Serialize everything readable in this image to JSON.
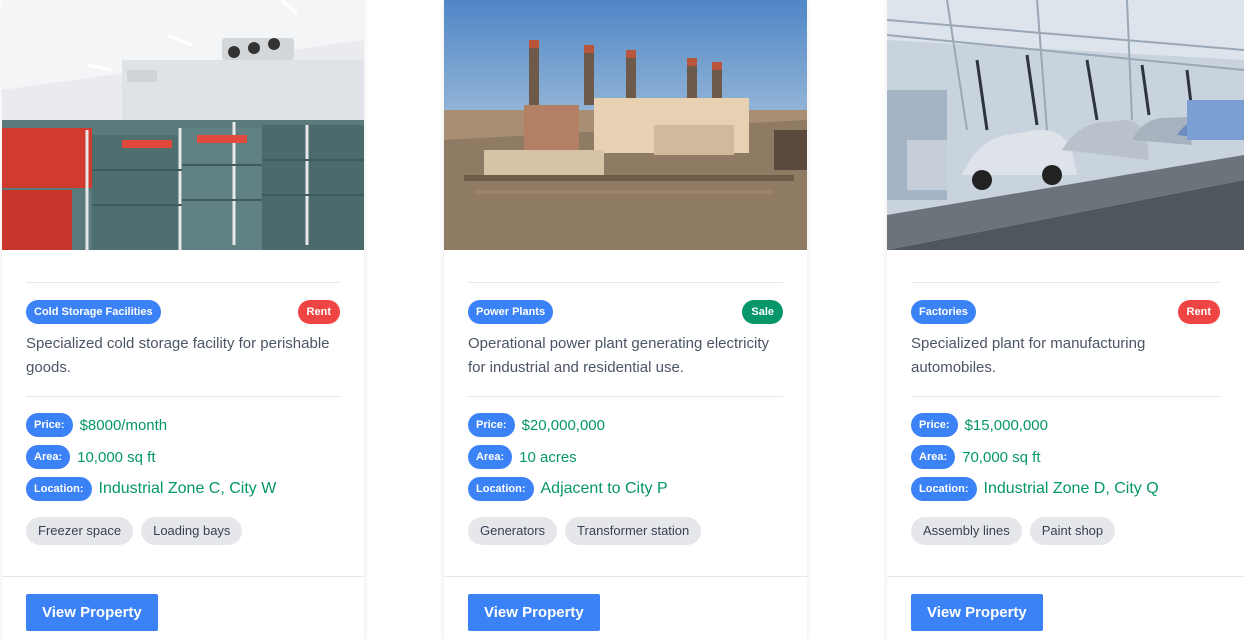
{
  "cards": [
    {
      "category": "Cold Storage Facilities",
      "deal": "Rent",
      "description": "Specialized cold storage facility for perishable goods.",
      "price_label": "Price:",
      "price": "$8000/month",
      "area_label": "Area:",
      "area": "10,000 sq ft",
      "location_label": "Location:",
      "location": "Industrial Zone C, City W",
      "features": [
        "Freezer space",
        "Loading bays"
      ],
      "button": "View Property"
    },
    {
      "category": "Power Plants",
      "deal": "Sale",
      "description": "Operational power plant generating electricity for industrial and residential use.",
      "price_label": "Price:",
      "price": "$20,000,000",
      "area_label": "Area:",
      "area": "10 acres",
      "location_label": "Location:",
      "location": "Adjacent to City P",
      "features": [
        "Generators",
        "Transformer station"
      ],
      "button": "View Property"
    },
    {
      "category": "Factories",
      "deal": "Rent",
      "description": "Specialized plant for manufacturing automobiles.",
      "price_label": "Price:",
      "price": "$15,000,000",
      "area_label": "Area:",
      "area": "70,000 sq ft",
      "location_label": "Location:",
      "location": "Industrial Zone D, City Q",
      "features": [
        "Assembly lines",
        "Paint shop"
      ],
      "button": "View Property"
    }
  ],
  "colors": {
    "primary": "#3b82f6",
    "rent": "#ef4444",
    "sale": "#059669",
    "value": "#059669"
  }
}
